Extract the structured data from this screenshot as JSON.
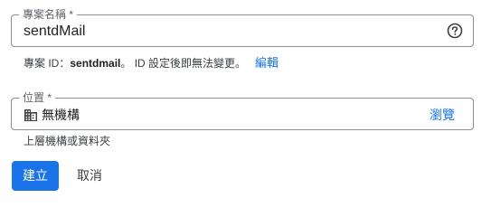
{
  "project_name_field": {
    "label": "專案名稱 *",
    "value": "sentdMail",
    "help_icon": "help-circle-icon"
  },
  "project_id": {
    "prefix": "專案 ID：",
    "value": "sentdmail",
    "suffix": "。 ID 設定後即無法變更。",
    "edit_label": "編輯"
  },
  "location_field": {
    "label": "位置 *",
    "icon": "building-icon",
    "value": "無機構",
    "browse_label": "瀏覽",
    "helper": "上層機構或資料夾"
  },
  "actions": {
    "create_label": "建立",
    "cancel_label": "取消"
  },
  "colors": {
    "accent": "#1a73e8",
    "border": "#8d8d8d",
    "label": "#5f6368"
  }
}
